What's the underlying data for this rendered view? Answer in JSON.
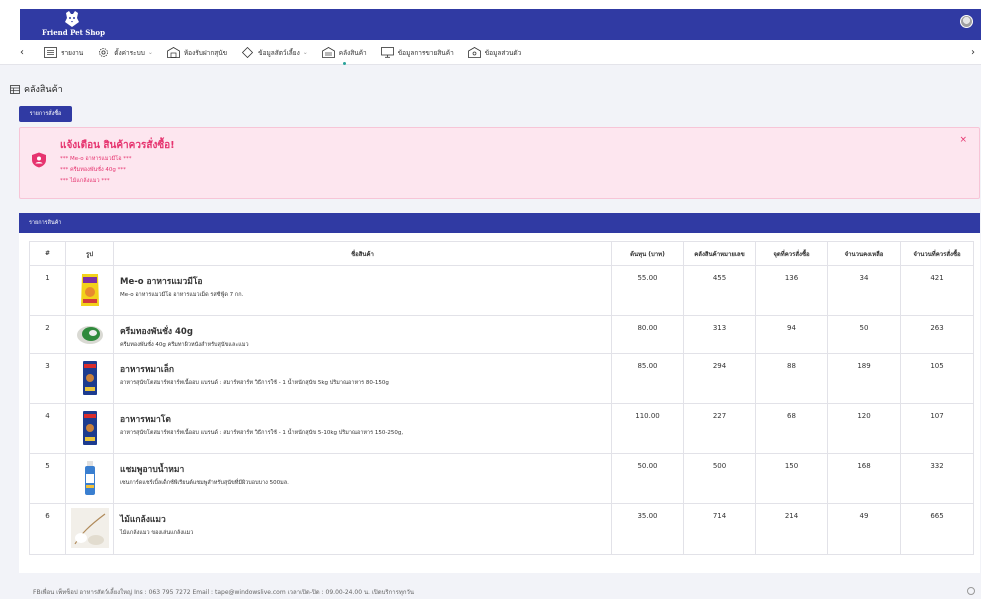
{
  "app": {
    "brand": "Friend Pet Shop"
  },
  "nav": {
    "items": [
      {
        "label": "รายงาน",
        "icon": "list-icon"
      },
      {
        "label": "ตั้งค่าระบบ",
        "icon": "gear-icon",
        "dropdown": true
      },
      {
        "label": "ห้องรับฝากสุนัข",
        "icon": "building-icon"
      },
      {
        "label": "ข้อมูลสัตว์เลี้ยง",
        "icon": "diamond-icon",
        "dropdown": true
      },
      {
        "label": "คลังสินค้า",
        "icon": "warehouse-icon",
        "active": true
      },
      {
        "label": "ข้อมูลการขายสินค้า",
        "icon": "monitor-icon"
      },
      {
        "label": "ข้อมูลส่วนตัว",
        "icon": "profile-icon"
      }
    ]
  },
  "page": {
    "title": "คลังสินค้า",
    "order_button": "รายการสั่งซื้อ"
  },
  "alert": {
    "title": "แจ้งเตือน สินค้าควรสั่งซื้อ!",
    "items": [
      "*** Me-o อาหารแมวมีโอ ***",
      "*** ครีมทองพันชั่ง 40g ***",
      "*** ไม้แกล้งแมว ***"
    ],
    "close": "×"
  },
  "table": {
    "title": "รายการสินค้า",
    "columns": [
      "#",
      "รูป",
      "ชื่อสินค้า",
      "ต้นทุน (บาท)",
      "คลังสินค้าหมายเลข",
      "จุดที่ควรสั่งซื้อ",
      "จำนวนคงเหลือ",
      "จำนวนที่ควรสั่งซื้อ"
    ],
    "rows": [
      {
        "idx": "1",
        "name": "Me-o อาหารแมวมีโอ",
        "desc": "Me-o อาหารแมวมีโอ อาหารแมวเม็ด รสซีฟู้ด 7 กก.",
        "cost": "55.00",
        "stock": "455",
        "reorder": "136",
        "remain": "34",
        "order_qty": "421",
        "reorder_warn": true,
        "order_warn": true,
        "image": "cat-food-bag-image"
      },
      {
        "idx": "2",
        "name": "ครีมทองพันชั่ง 40g",
        "desc": "ครีมทองพันชั่ง 40g ครีมทาผิวหนังสำหรับสุนัขและแมว",
        "cost": "80.00",
        "stock": "313",
        "reorder": "94",
        "remain": "50",
        "order_qty": "263",
        "reorder_warn": true,
        "order_warn": true,
        "image": "cream-jar-image"
      },
      {
        "idx": "3",
        "name": "อาหารหมาเล็ก",
        "desc": "อาหารสุนัขโตสมาร์ทฮาร์ทเนื้ออบ แบรนด์ : สมาร์ทฮาร์ท วิธีการใช้ - 1 น้ำหนักสุนัข 5kg ปริมาณอาหาร 80-150g",
        "cost": "85.00",
        "stock": "294",
        "reorder": "88",
        "remain": "189",
        "order_qty": "105",
        "reorder_warn": false,
        "order_warn": false,
        "image": "dog-food-bag-image"
      },
      {
        "idx": "4",
        "name": "อาหารหมาโต",
        "desc": "อาหารสุนัขโตสมาร์ทฮาร์ทเนื้ออบ แบรนด์ : สมาร์ทฮาร์ท วิธีการใช้ - 1 น้ำหนักสุนัข 5-10kg ปริมาณอาหาร 150-250g,",
        "cost": "110.00",
        "stock": "227",
        "reorder": "68",
        "remain": "120",
        "order_qty": "107",
        "reorder_warn": false,
        "order_warn": false,
        "image": "dog-food-bag-image"
      },
      {
        "idx": "5",
        "name": "แชมพูอาบน้ำหมา",
        "desc": "เซนการ์ดแชร์เบิ้ลเด็กซ์พีเรียนต์แชมพูสำหรับสุนัขที่มีผิวบอบบาง 500มล.",
        "cost": "50.00",
        "stock": "500",
        "reorder": "150",
        "remain": "168",
        "order_qty": "332",
        "reorder_warn": false,
        "order_warn": false,
        "image": "shampoo-bottle-image"
      },
      {
        "idx": "6",
        "name": "ไม้แกล้งแมว",
        "desc": "ไม้แกล้งแมว ของเล่นแกล้งแมว",
        "cost": "35.00",
        "stock": "714",
        "reorder": "214",
        "remain": "49",
        "order_qty": "665",
        "reorder_warn": true,
        "order_warn": true,
        "image": "cat-teaser-image"
      }
    ]
  },
  "footer": {
    "text": "FBเพื่อน เพ็ทช็อป อาหารสัตว์เลี้ยงใหญ่ Ins : 063 795 7272 Email : tape@windowslive.com เวลาเปิด-ปิด : 09.00-24.00 น. เปิดบริการทุกวัน"
  },
  "colors": {
    "primary": "#303aa3",
    "warn": "#e6346f",
    "alert_bg": "#fde6ef",
    "active_dot": "#2aa39a"
  }
}
